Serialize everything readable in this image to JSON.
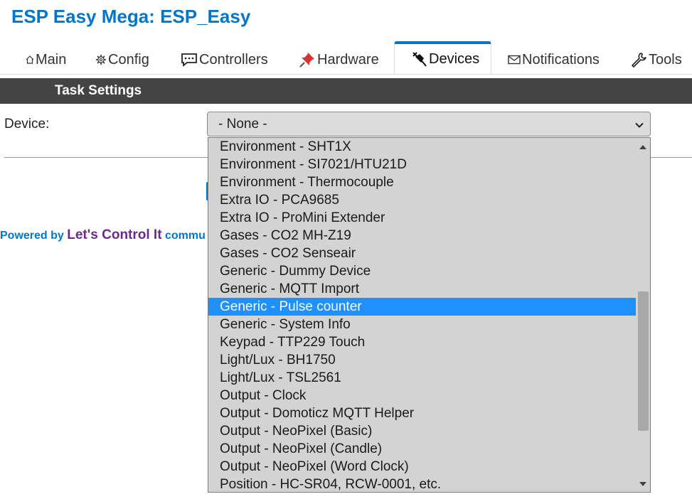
{
  "header": {
    "title": "ESP Easy Mega: ESP_Easy"
  },
  "tabs": [
    {
      "label": "Main",
      "icon": "home-icon",
      "active": false
    },
    {
      "label": "Config",
      "icon": "gear-icon",
      "active": false
    },
    {
      "label": "Controllers",
      "icon": "chat-bubble-icon",
      "active": false
    },
    {
      "label": "Hardware",
      "icon": "pushpin-icon",
      "active": false
    },
    {
      "label": "Devices",
      "icon": "plug-icon",
      "active": true
    },
    {
      "label": "Notifications",
      "icon": "envelope-icon",
      "active": false
    },
    {
      "label": "Tools",
      "icon": "wrench-icon",
      "active": false
    }
  ],
  "section": {
    "title": "Task Settings"
  },
  "device": {
    "label": "Device:",
    "selected_value": "- None -"
  },
  "footer": {
    "powered_by": "Powered by ",
    "link": "Let's Control It",
    "suffix": " commu"
  },
  "dropdown": {
    "options": [
      "Environment - SHT1X",
      "Environment - SI7021/HTU21D",
      "Environment - Thermocouple",
      "Extra IO - PCA9685",
      "Extra IO - ProMini Extender",
      "Gases - CO2 MH-Z19",
      "Gases - CO2 Senseair",
      "Generic - Dummy Device",
      "Generic - MQTT Import",
      "Generic - Pulse counter",
      "Generic - System Info",
      "Keypad - TTP229 Touch",
      "Light/Lux - BH1750",
      "Light/Lux - TSL2561",
      "Output - Clock",
      "Output - Domoticz MQTT Helper",
      "Output - NeoPixel (Basic)",
      "Output - NeoPixel (Candle)",
      "Output - NeoPixel (Word Clock)",
      "Position - HC-SR04, RCW-0001, etc."
    ],
    "highlighted": "Generic - Pulse counter"
  },
  "colors": {
    "accent": "#0077cc",
    "section_bar": "#444444",
    "highlight": "#1e90ff",
    "link_purple": "#6a2a8a"
  }
}
